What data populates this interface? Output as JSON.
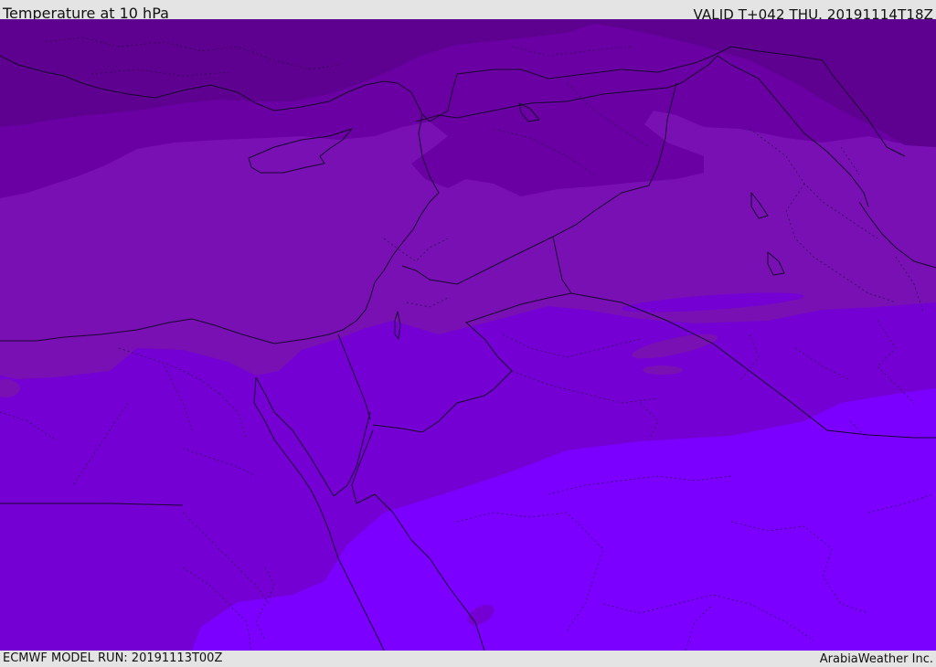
{
  "header": {
    "title": "Temperature at 10 hPa",
    "valid_time": "VALID T+042 THU. 20191114T18Z"
  },
  "footer": {
    "model_run": "ECMWF MODEL RUN: 20191113T00Z",
    "credit": "ArabiaWeather Inc."
  },
  "colors": {
    "band_1": "#5e0090",
    "band_2": "#6a00a4",
    "band_3": "#7810b4",
    "band_4": "#7400d4",
    "band_5": "#7b00ff",
    "border": "#1a0630"
  }
}
